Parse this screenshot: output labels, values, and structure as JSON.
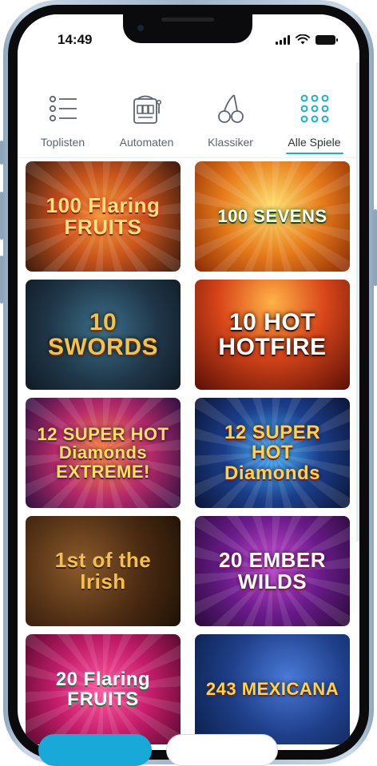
{
  "status_bar": {
    "time": "14:49"
  },
  "tabs": [
    {
      "label": "Toplisten",
      "icon": "list-icon",
      "active": false
    },
    {
      "label": "Automaten",
      "icon": "slot-machine-icon",
      "active": false
    },
    {
      "label": "Klassiker",
      "icon": "cherries-icon",
      "active": false
    },
    {
      "label": "Alle Spiele",
      "icon": "grid-dots-icon",
      "active": true
    }
  ],
  "games": [
    {
      "title": "100 Flaring FRUITS"
    },
    {
      "title": "100 SEVENS"
    },
    {
      "title": "10 SWORDS"
    },
    {
      "title": "10 HOT HOTFIRE"
    },
    {
      "title": "12 SUPER HOT Diamonds EXTREME!"
    },
    {
      "title": "12 SUPER HOT Diamonds"
    },
    {
      "title": "1st of the Irish"
    },
    {
      "title": "20 EMBER WILDS"
    },
    {
      "title": "20 Flaring FRUITS"
    },
    {
      "title": "243 MEXICANA"
    }
  ],
  "colors": {
    "accent": "#1bb1c6",
    "primary_button": "#19a9d8"
  }
}
